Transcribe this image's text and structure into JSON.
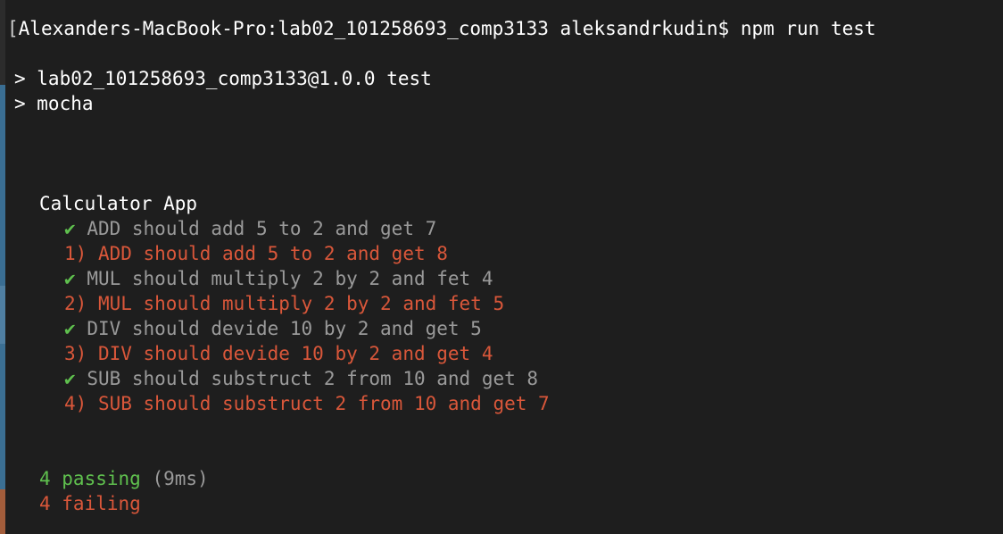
{
  "colors": {
    "background": "#1e1e1e",
    "text": "#ededed",
    "pass_check": "#5fc04e",
    "pass_text": "#9a9a9a",
    "fail_text": "#d9573a",
    "passing_summary": "#5fc04e",
    "failing_summary": "#d9573a"
  },
  "prompt": {
    "bracket": "[",
    "host_path": "Alexanders-MacBook-Pro:lab02_101258693_comp3133 aleksandrkudin$",
    "command": "npm run test"
  },
  "npm_output": {
    "script_line": "> lab02_101258693_comp3133@1.0.0 test",
    "runner_line": "> mocha"
  },
  "suite": {
    "title": "Calculator App",
    "tests": [
      {
        "status": "pass",
        "mark": "✔",
        "text": "ADD should add 5 to 2 and get 7"
      },
      {
        "status": "fail",
        "mark": "1)",
        "text": "ADD should add 5 to 2 and get 8"
      },
      {
        "status": "pass",
        "mark": "✔",
        "text": "MUL should multiply 2 by 2 and fet 4"
      },
      {
        "status": "fail",
        "mark": "2)",
        "text": "MUL should multiply 2 by 2 and fet 5"
      },
      {
        "status": "pass",
        "mark": "✔",
        "text": "DIV should devide 10 by 2 and get 5"
      },
      {
        "status": "fail",
        "mark": "3)",
        "text": "DIV should devide 10 by 2 and get 4"
      },
      {
        "status": "pass",
        "mark": "✔",
        "text": "SUB should substruct 2 from 10 and get 8"
      },
      {
        "status": "fail",
        "mark": "4)",
        "text": "SUB should substruct 2 from 10 and get 7"
      }
    ]
  },
  "summary": {
    "passing": "4 passing",
    "passing_time": "(9ms)",
    "failing": "4 failing"
  }
}
